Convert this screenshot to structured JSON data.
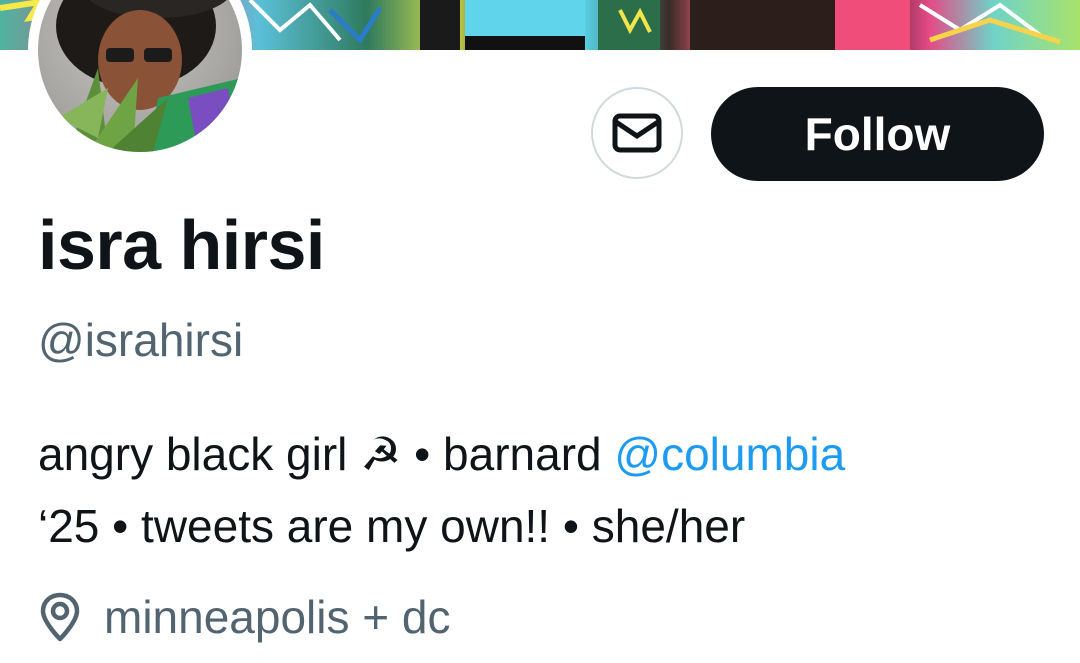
{
  "profile": {
    "display_name": "isra hirsi",
    "handle": "@israhirsi",
    "bio": {
      "part1": "angry black girl",
      "emoji": "☭",
      "part2": " • barnard ",
      "mention": "@columbia",
      "line2": "‘25 • tweets are my own!! • she/her"
    },
    "location": "minneapolis + dc"
  },
  "actions": {
    "follow_label": "Follow",
    "message_icon": "mail-icon"
  },
  "icons": {
    "location": "location-pin-icon",
    "message": "mail-icon"
  },
  "colors": {
    "text_primary": "#0f1419",
    "text_secondary": "#536471",
    "link": "#1d9bf0",
    "follow_bg": "#0f1419",
    "border": "#cfd9de"
  }
}
